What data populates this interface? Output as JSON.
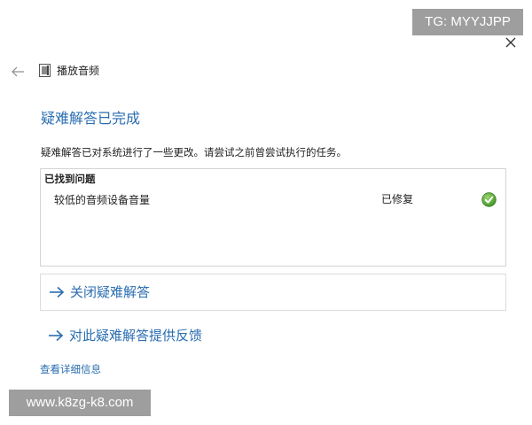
{
  "watermark": {
    "top_right": "TG: MYYJJPP",
    "bottom_left": "www.k8zg-k8.com"
  },
  "header": {
    "back_icon": "arrow-left-icon",
    "app_icon": "troubleshooter-icon",
    "title": "播放音频",
    "close_icon": "close-icon"
  },
  "main": {
    "heading": "疑难解答已完成",
    "description": "疑难解答已对系统进行了一些更改。请尝试之前曾尝试执行的任务。",
    "results": {
      "title": "已找到问题",
      "items": [
        {
          "problem": "较低的音频设备音量",
          "status": "已修复",
          "status_icon": "check-circle-icon"
        }
      ]
    },
    "actions": {
      "close_troubleshooter": "关闭疑难解答",
      "feedback": "对此疑难解答提供反馈"
    },
    "details_link": "查看详细信息"
  },
  "colors": {
    "accent": "#2a6db0",
    "success": "#5aa83a",
    "border": "#d4d4d4",
    "watermark_bg": "#9e9e9e"
  }
}
